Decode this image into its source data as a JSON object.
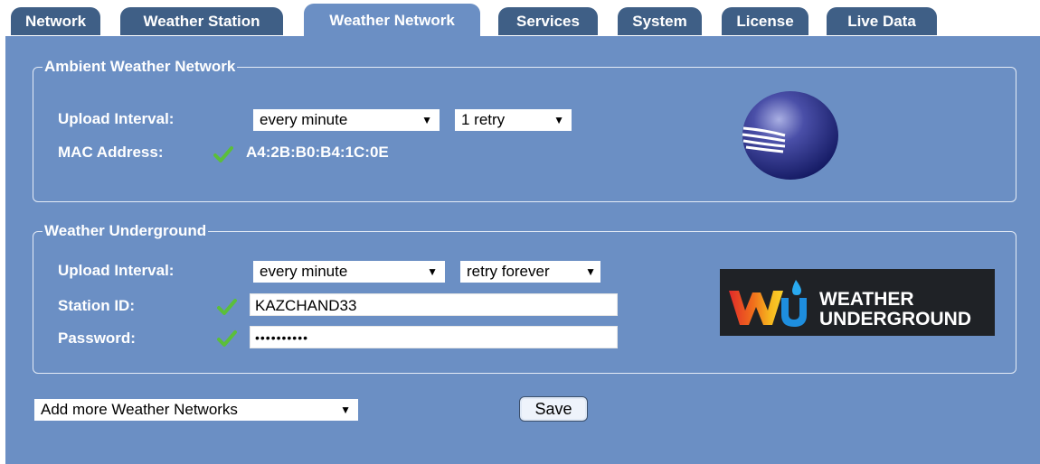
{
  "tabs": [
    {
      "label": "Network"
    },
    {
      "label": "Weather Station"
    },
    {
      "label": "Weather Network"
    },
    {
      "label": "Services"
    },
    {
      "label": "System"
    },
    {
      "label": "License"
    },
    {
      "label": "Live Data"
    }
  ],
  "active_tab": "Weather Network",
  "ambient": {
    "legend": "Ambient Weather Network",
    "upload_label": "Upload Interval:",
    "upload_interval": "every minute",
    "retry": "1 retry",
    "mac_label": "MAC Address:",
    "mac_value": "A4:2B:B0:B4:1C:0E"
  },
  "wunderground": {
    "legend": "Weather Underground",
    "upload_label": "Upload Interval:",
    "upload_interval": "every minute",
    "retry": "retry forever",
    "station_label": "Station ID:",
    "station_id": "KAZCHAND33",
    "password_label": "Password:",
    "password_value": "••••••••••",
    "logo_line1": "WEATHER",
    "logo_line2": "UNDERGROUND"
  },
  "footer": {
    "add_networks": "Add more Weather Networks",
    "save_label": "Save"
  },
  "icons": {
    "arrow": "▼",
    "check_color": "#5bbf3a"
  },
  "colors": {
    "panel": "#6b8fc4",
    "tab": "#3f5f86"
  }
}
